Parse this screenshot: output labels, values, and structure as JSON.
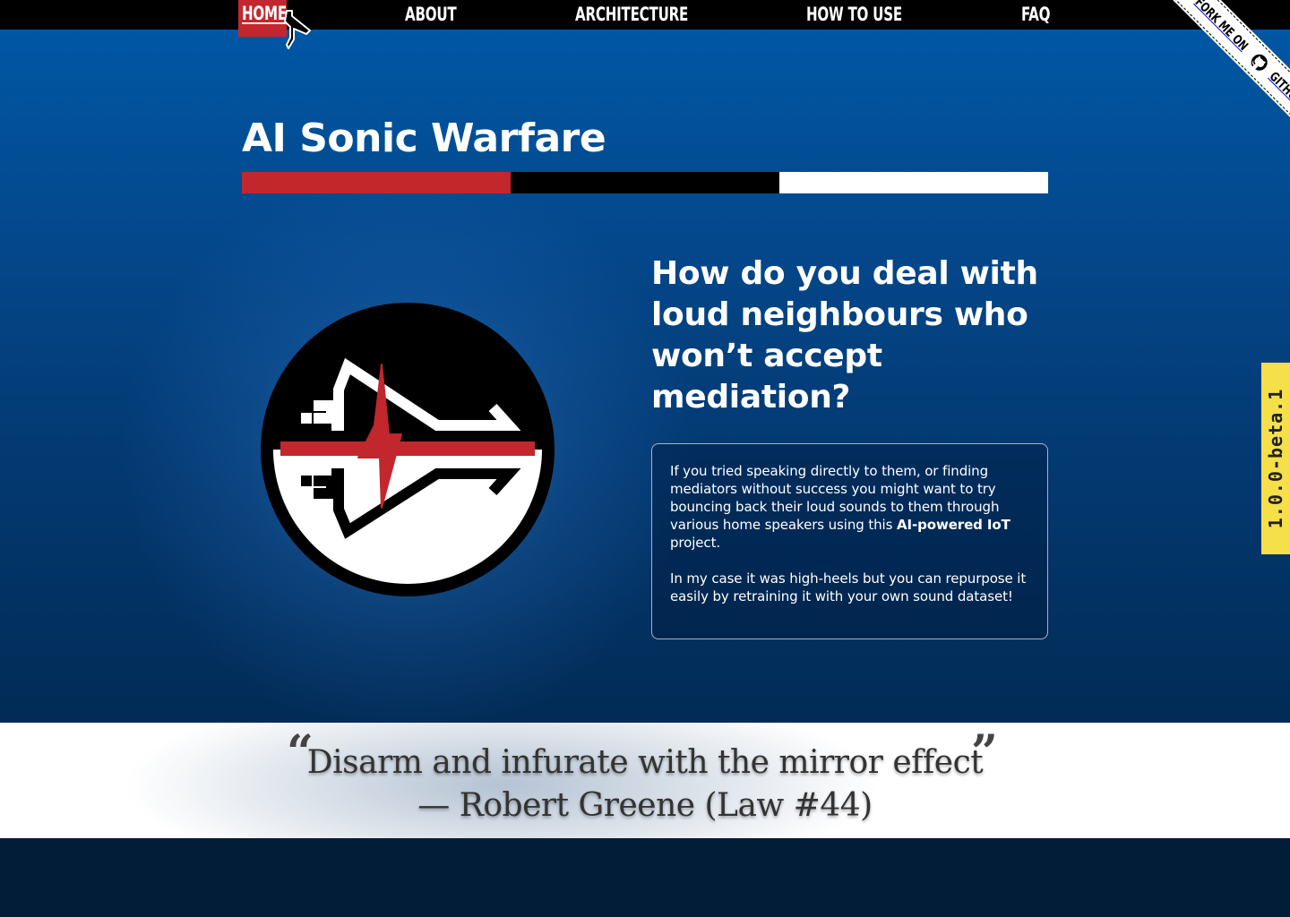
{
  "nav": {
    "home_label": "HOME",
    "items": [
      {
        "label": "ABOUT"
      },
      {
        "label": "ARCHITECTURE"
      },
      {
        "label": "HOW TO USE"
      },
      {
        "label": "FAQ"
      }
    ]
  },
  "ribbon": {
    "text_before": "FORK ME ON",
    "text_after": "GITHUB",
    "icon": "github-icon"
  },
  "hero": {
    "title": "AI Sonic Warfare",
    "question": "How do you deal with loud neighbours who won’t accept mediation?",
    "paragraph1_pre": "If you tried speaking directly to them, or finding mediators without success you might want to try bouncing back their loud sounds to them through various home speakers using this ",
    "paragraph1_bold": "AI-powered IoT",
    "paragraph1_post": " project.",
    "paragraph2": "In my case it was high-heels but you can repurpose it easily by retraining it with your own sound dataset!"
  },
  "colors": {
    "brand_red": "#c1272d",
    "brand_black": "#000000",
    "brand_white": "#ffffff",
    "hero_blue": "#0057a4",
    "version_yellow": "#f5e04a"
  },
  "version": {
    "label": "1.0.0-beta.1"
  },
  "quote": {
    "open_mark": "“",
    "close_mark": "”",
    "text": "Disarm and infurate with the mirror effect",
    "attribution": "— Robert Greene (Law #44)"
  }
}
